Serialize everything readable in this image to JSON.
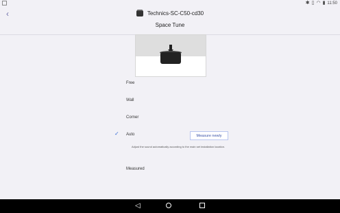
{
  "status_bar": {
    "time": "11:50",
    "icons": [
      "bluetooth-icon",
      "vibrate-icon",
      "wifi-icon",
      "battery-icon"
    ],
    "left_icon": "square-icon"
  },
  "header": {
    "back_icon": "chevron-left-icon",
    "device_name": "Technics-SC-C50-cd30",
    "title": "Space Tune"
  },
  "options": {
    "free": "Free",
    "wall": "Wall",
    "corner": "Corner",
    "auto": "Auto",
    "measured": "Measured"
  },
  "auto": {
    "selected": true,
    "button_label": "Measure newly",
    "description": "Adjust the sound automatically according to the main set installation location."
  },
  "colors": {
    "accent": "#3c6fd6",
    "background": "#f2f1f6",
    "nav_bar": "#000000"
  },
  "nav": {
    "back_icon": "back-triangle-icon",
    "home_icon": "home-circle-icon",
    "recents_icon": "recents-square-icon"
  }
}
